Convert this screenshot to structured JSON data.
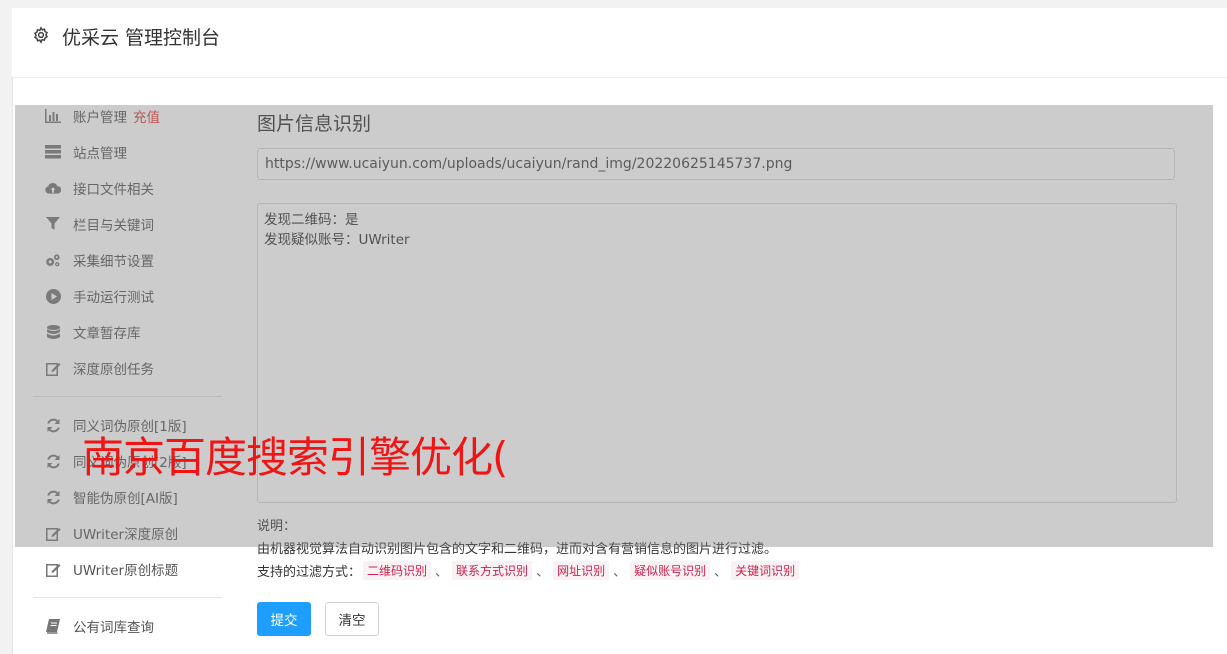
{
  "header": {
    "title": "优采云 管理控制台",
    "icon": "gear-icon"
  },
  "sidebar": {
    "items": [
      {
        "label": "账户管理",
        "badge": "充值",
        "icon": "bar-chart-icon"
      },
      {
        "label": "站点管理",
        "icon": "server-icon"
      },
      {
        "label": "接口文件相关",
        "icon": "cloud-upload-icon"
      },
      {
        "label": "栏目与关键词",
        "icon": "filter-icon"
      },
      {
        "label": "采集细节设置",
        "icon": "gears-icon"
      },
      {
        "label": "手动运行测试",
        "icon": "play-circle-icon"
      },
      {
        "label": "文章暂存库",
        "icon": "database-icon"
      },
      {
        "label": "深度原创任务",
        "icon": "edit-icon"
      },
      {
        "label": "同义词伪原创[1版]",
        "icon": "refresh-icon"
      },
      {
        "label": "同义词伪原创[2版]",
        "icon": "refresh-icon"
      },
      {
        "label": "智能伪原创[AI版]",
        "icon": "refresh-icon"
      },
      {
        "label": "UWriter深度原创",
        "icon": "edit-icon"
      },
      {
        "label": "UWriter原创标题",
        "icon": "edit-icon"
      },
      {
        "label": "公有词库查询",
        "icon": "book-icon"
      }
    ]
  },
  "main": {
    "title": "图片信息识别",
    "url_value": "https://www.ucaiyun.com/uploads/ucaiyun/rand_img/20220625145737.png",
    "result_lines": [
      "发现二维码：是",
      "发现疑似账号：UWriter"
    ],
    "note_label": "说明：",
    "note_text": "由机器视觉算法自动识别图片包含的文字和二维码，进而对含有营销信息的图片进行过滤。",
    "filter_label": "支持的过滤方式：",
    "filters": [
      "二维码识别",
      "联系方式识别",
      "网址识别",
      "疑似账号识别",
      "关键词识别"
    ],
    "separator": "、",
    "submit_label": "提交",
    "clear_label": "清空"
  },
  "watermark": "南京百度搜索引擎优化("
}
